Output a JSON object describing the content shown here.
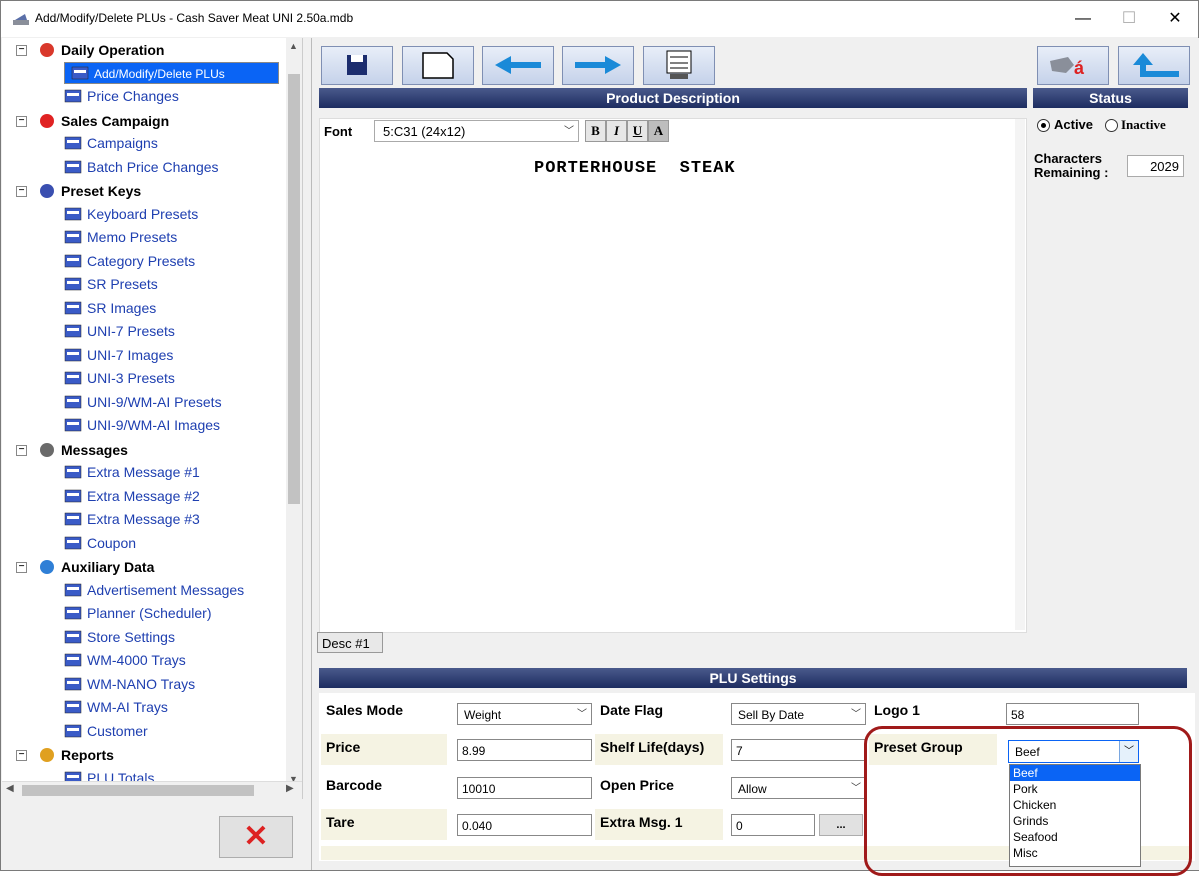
{
  "window": {
    "title": "Add/Modify/Delete PLUs - Cash Saver Meat UNI 2.50a.mdb",
    "minimize": "—",
    "maximize": "☐",
    "close": "✕"
  },
  "tree": {
    "groups": [
      {
        "label": "Daily Operation",
        "items": [
          "Add/Modify/Delete PLUs",
          "Price Changes"
        ]
      },
      {
        "label": "Sales Campaign",
        "items": [
          "Campaigns",
          "Batch Price Changes"
        ]
      },
      {
        "label": "Preset Keys",
        "items": [
          "Keyboard Presets",
          "Memo Presets",
          "Category Presets",
          "SR Presets",
          "SR Images",
          "UNI-7 Presets",
          "UNI-7 Images",
          "UNI-3 Presets",
          "UNI-9/WM-AI Presets",
          "UNI-9/WM-AI Images"
        ]
      },
      {
        "label": "Messages",
        "items": [
          "Extra Message #1",
          "Extra Message #2",
          "Extra Message #3",
          "Coupon"
        ]
      },
      {
        "label": "Auxiliary Data",
        "items": [
          "Advertisement Messages",
          "Planner (Scheduler)",
          "Store Settings",
          "WM-4000 Trays",
          "WM-NANO Trays",
          "WM-AI Trays",
          "Customer"
        ]
      },
      {
        "label": "Reports",
        "items": [
          "PLU Totals"
        ]
      }
    ],
    "selected": "Add/Modify/Delete PLUs"
  },
  "headers": {
    "product_description": "Product Description",
    "status": "Status",
    "plu_settings": "PLU Settings"
  },
  "description": {
    "font_label": "Font",
    "font_value": "5:C31 (24x12)",
    "format_buttons": [
      "B",
      "I",
      "U",
      "A"
    ],
    "text": "PORTERHOUSE  STEAK",
    "tab_label": "Desc #1"
  },
  "status": {
    "active_label": "Active",
    "inactive_label": "Inactive",
    "selected": "Active",
    "chars_label_1": "Characters",
    "chars_label_2": "Remaining :",
    "chars_value": "2029"
  },
  "plu": {
    "sales_mode_label": "Sales Mode",
    "sales_mode_value": "Weight",
    "price_label": "Price",
    "price_value": "8.99",
    "barcode_label": "Barcode",
    "barcode_value": "10010",
    "tare_label": "Tare",
    "tare_value": "0.040",
    "date_flag_label": "Date Flag",
    "date_flag_value": "Sell By Date",
    "shelf_life_label": "Shelf Life(days)",
    "shelf_life_value": "7",
    "open_price_label": "Open Price",
    "open_price_value": "Allow",
    "extra_msg_label": "Extra Msg. 1",
    "extra_msg_value": "0",
    "extra_msg_button": "...",
    "logo_label": "Logo 1",
    "logo_value": "58",
    "preset_group_label": "Preset Group",
    "preset_group_value": "Beef",
    "preset_group_options": [
      "Beef",
      "Pork",
      "Chicken",
      "Grinds",
      "Seafood",
      "Misc"
    ]
  },
  "colors": {
    "accent": "#0a64f5",
    "header_bar": "#1d2c60",
    "highlight_ring": "#a01a1a"
  }
}
